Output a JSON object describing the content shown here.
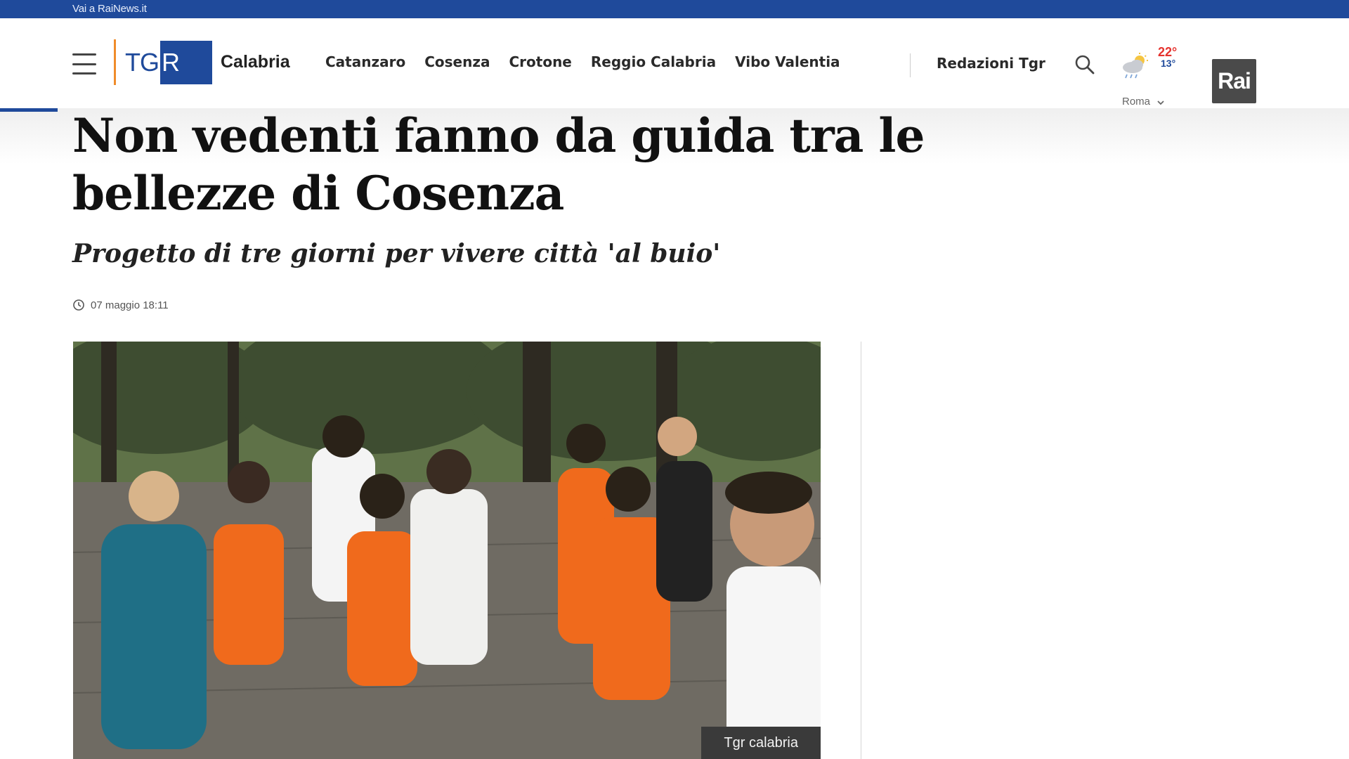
{
  "topbar": {
    "link": "Vai a RaiNews.it"
  },
  "header": {
    "logo_tg": "TG",
    "logo_r": "R",
    "region": "Calabria",
    "nav": [
      "Catanzaro",
      "Cosenza",
      "Crotone",
      "Reggio Calabria",
      "Vibo Valentia"
    ],
    "redazioni": "Redazioni Tgr",
    "search_icon": "search-icon",
    "weather": {
      "temp_max": "22°",
      "temp_min": "13°",
      "city": "Roma",
      "icon": "rain-cloud-icon"
    },
    "brand": "Rai"
  },
  "article": {
    "title": "Non vedenti fanno da guida tra le bellezze di Cosenza",
    "subtitle": "Progetto di tre giorni per vivere città 'al buio'",
    "date": "07 maggio 18:11",
    "photo_caption": "Tgr calabria"
  },
  "colors": {
    "brand_blue": "#1f4a9b",
    "accent_orange": "#f08c2a",
    "temp_hot": "#e5322d"
  }
}
